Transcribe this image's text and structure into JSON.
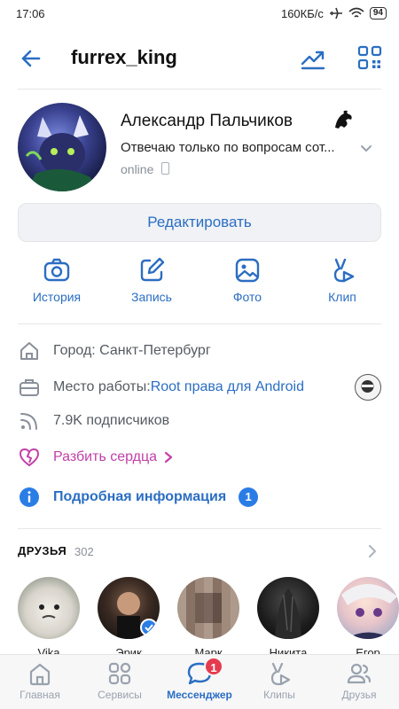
{
  "statusbar": {
    "time": "17:06",
    "network_speed": "160КБ/с",
    "battery": "94",
    "icons": [
      "airplane-icon",
      "wifi-icon",
      "battery-icon"
    ]
  },
  "header": {
    "username": "furrex_king",
    "icons": [
      "back-arrow-icon",
      "stats-icon",
      "qr-code-icon"
    ]
  },
  "profile": {
    "name": "Александр Пальчиков",
    "status": "Отвечаю только по вопросам сот...",
    "online": "online",
    "edit_button": "Редактировать"
  },
  "actions": [
    {
      "label": "История",
      "icon": "camera-icon"
    },
    {
      "label": "Запись",
      "icon": "edit-post-icon"
    },
    {
      "label": "Фото",
      "icon": "photo-icon"
    },
    {
      "label": "Клип",
      "icon": "clip-icon"
    }
  ],
  "info": {
    "city_label": "Город: Санкт-Петербург",
    "work_label": "Место работы: ",
    "work_link": "Root права для Android",
    "followers": "7.9K подписчиков",
    "hearts": "Разбить сердца",
    "more": "Подробная информация",
    "more_badge": "1"
  },
  "friends": {
    "title": "ДРУЗЬЯ",
    "count": "302",
    "items": [
      {
        "name": "Vika"
      },
      {
        "name": "Эрик"
      },
      {
        "name": "Марк"
      },
      {
        "name": "Никита"
      },
      {
        "name": "Егор"
      }
    ]
  },
  "tabbar": {
    "tabs": [
      {
        "label": "Главная",
        "icon": "home-icon"
      },
      {
        "label": "Сервисы",
        "icon": "services-icon"
      },
      {
        "label": "Мессенджер",
        "icon": "messenger-icon",
        "badge": "1"
      },
      {
        "label": "Клипы",
        "icon": "clips-icon"
      },
      {
        "label": "Друзья",
        "icon": "friends-icon"
      }
    ]
  },
  "colors": {
    "accent": "#2b6ec2",
    "hearts": "#c240a8",
    "badge_red": "#e63b4f",
    "badge_blue": "#2b7de6"
  }
}
